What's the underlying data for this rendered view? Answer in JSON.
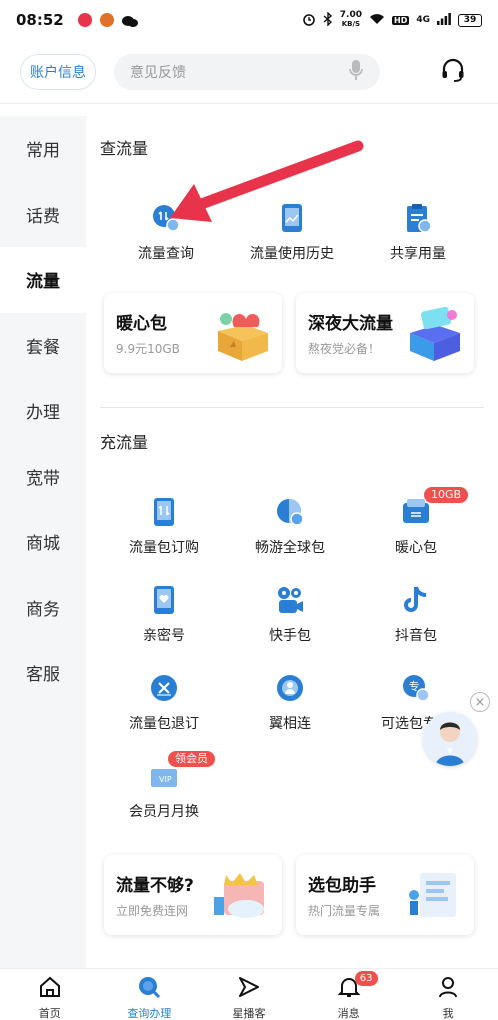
{
  "status_bar": {
    "time": "08:52",
    "network_speed": "7.00",
    "speed_unit": "KB/S",
    "hd": "HD",
    "signal": "4G",
    "battery": "39"
  },
  "header": {
    "account_label": "账户信息",
    "search_placeholder": "意见反馈"
  },
  "sidebar": {
    "items": [
      "常用",
      "话费",
      "流量",
      "套餐",
      "办理",
      "宽带",
      "商城",
      "商务",
      "客服"
    ],
    "active_index": 2
  },
  "query_section": {
    "title": "查流量",
    "items": [
      {
        "label": "流量查询",
        "icon": "data-query-icon"
      },
      {
        "label": "流量使用历史",
        "icon": "usage-history-icon"
      },
      {
        "label": "共享用量",
        "icon": "shared-usage-icon"
      }
    ]
  },
  "promo_cards_top": [
    {
      "title": "暖心包",
      "subtitle": "9.9元10GB"
    },
    {
      "title": "深夜大流量",
      "subtitle": "熬夜党必备！"
    }
  ],
  "recharge_section": {
    "title": "充流量",
    "items": [
      {
        "label": "流量包订购",
        "icon": "package-order-icon"
      },
      {
        "label": "畅游全球包",
        "icon": "global-roaming-icon"
      },
      {
        "label": "暖心包",
        "icon": "warm-package-icon",
        "badge": "10GB"
      },
      {
        "label": "亲密号",
        "icon": "family-number-icon"
      },
      {
        "label": "快手包",
        "icon": "kuaishou-icon"
      },
      {
        "label": "抖音包",
        "icon": "douyin-icon"
      },
      {
        "label": "流量包退订",
        "icon": "unsubscribe-icon"
      },
      {
        "label": "翼相连",
        "icon": "yi-connect-icon"
      },
      {
        "label": "可选包专区",
        "icon": "optional-package-icon"
      },
      {
        "label": "会员月月换",
        "icon": "vip-monthly-icon",
        "badge": "领会员"
      }
    ]
  },
  "promo_cards_bottom": [
    {
      "title": "流量不够?",
      "subtitle": "立即免费连网"
    },
    {
      "title": "选包助手",
      "subtitle": "热门流量专属"
    }
  ],
  "float": {
    "close": "×"
  },
  "bottom_nav": {
    "tabs": [
      {
        "label": "首页",
        "icon": "home-icon"
      },
      {
        "label": "查询办理",
        "icon": "query-icon"
      },
      {
        "label": "星播客",
        "icon": "star-podcast-icon"
      },
      {
        "label": "消息",
        "icon": "message-icon",
        "badge": "63"
      },
      {
        "label": "我",
        "icon": "profile-icon"
      }
    ],
    "active_index": 1
  },
  "colors": {
    "accent": "#2a7fd4",
    "arrow": "#e8344a",
    "badge": "#f0504d"
  }
}
